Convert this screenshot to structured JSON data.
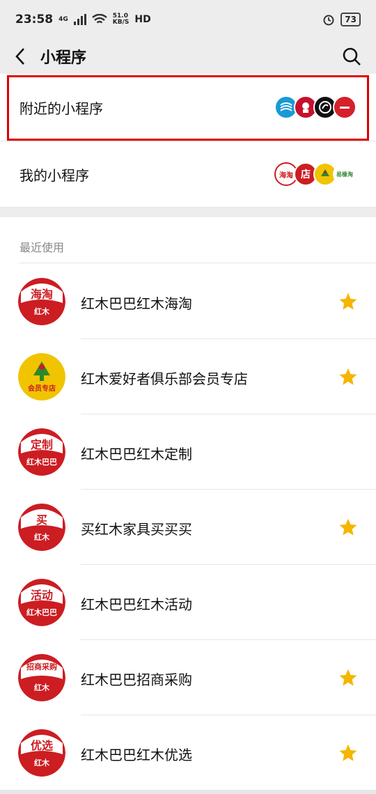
{
  "status": {
    "time": "23:58",
    "network": "4G",
    "speed": "51.0",
    "speed_unit": "KB/S",
    "hd": "HD",
    "battery": "73"
  },
  "nav": {
    "title": "小程序"
  },
  "rows": {
    "nearby_label": "附近的小程序",
    "mine_label": "我的小程序",
    "mine_logo_text": "海淘",
    "mine_logo_text2": "店",
    "mine_logo_text3": "易橡淘"
  },
  "recent": {
    "title": "最近使用",
    "items": [
      {
        "name": "红木巴巴红木海淘",
        "icon_top": "海淘",
        "icon_bottom": "红木",
        "starred": true
      },
      {
        "name": "红木爱好者俱乐部会员专店",
        "icon_top": "",
        "icon_bottom": "会员专店",
        "starred": true
      },
      {
        "name": "红木巴巴红木定制",
        "icon_top": "定制",
        "icon_bottom": "红木巴巴",
        "starred": false
      },
      {
        "name": "买红木家具买买买",
        "icon_top": "买",
        "icon_bottom": "红木",
        "starred": true
      },
      {
        "name": "红木巴巴红木活动",
        "icon_top": "活动",
        "icon_bottom": "红木巴巴",
        "starred": false
      },
      {
        "name": "红木巴巴招商采购",
        "icon_top": "招商采购",
        "icon_bottom": "红木",
        "starred": true
      },
      {
        "name": "红木巴巴红木优选",
        "icon_top": "优选",
        "icon_bottom": "红木",
        "starred": true
      }
    ]
  },
  "colors": {
    "brand_red": "#cc1d22",
    "star": "#f5b500",
    "highlight": "#e00000",
    "yellow": "#f0c400"
  }
}
